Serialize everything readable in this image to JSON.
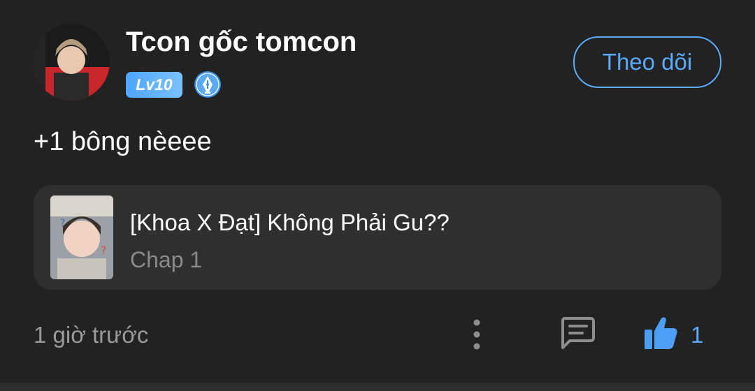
{
  "comment": {
    "username": "Tcon gốc tomcon",
    "level_badge": "Lv10",
    "rank_icon": "pen-nib-badge-icon",
    "follow_label": "Theo dõi",
    "text": "+1 bông nèeee",
    "time": "1 giờ trước",
    "like_count": "1"
  },
  "chapter_card": {
    "title": "[Khoa X Đạt] Không Phải Gu??",
    "subtitle": "Chap 1"
  },
  "actions": {
    "more_icon": "vertical-dots-icon",
    "reply_icon": "chat-bubble-icon",
    "like_icon": "thumbs-up-icon"
  },
  "colors": {
    "background": "#222222",
    "card": "#2f2f2f",
    "accent": "#5aabff",
    "muted_text": "#9a9a9a"
  }
}
